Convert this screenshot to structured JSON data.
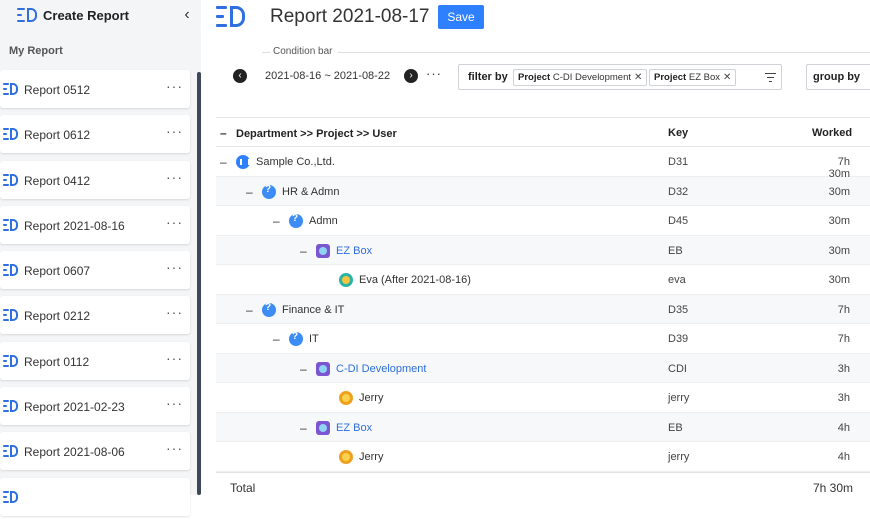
{
  "sidebar": {
    "title": "Create Report",
    "section": "My Report",
    "items": [
      {
        "label": "Report 0512"
      },
      {
        "label": "Report 0612"
      },
      {
        "label": "Report 0412"
      },
      {
        "label": "Report 2021-08-16"
      },
      {
        "label": "Report 0607"
      },
      {
        "label": "Report 0212"
      },
      {
        "label": "Report 0112"
      },
      {
        "label": "Report 2021-02-23"
      },
      {
        "label": "Report 2021-08-06"
      }
    ],
    "more_glyph": "···"
  },
  "header": {
    "title": "Report 2021-08-17",
    "save_label": "Save"
  },
  "condition_bar": {
    "label": "Condition bar",
    "date_range": "2021-08-16 ~ 2021-08-22",
    "more_glyph": "···",
    "filter_label": "filter by",
    "filters": [
      {
        "field": "Project",
        "value": "C-DI Development"
      },
      {
        "field": "Project",
        "value": "EZ Box"
      }
    ],
    "group_label": "group by"
  },
  "table": {
    "header": {
      "name": "Department >> Project >> User",
      "key": "Key",
      "worked": "Worked"
    },
    "rows": [
      {
        "name": "Sample Co.,Ltd.",
        "key": "D31",
        "worked": "7h 30m"
      },
      {
        "name": "HR & Admn",
        "key": "D32",
        "worked": "30m"
      },
      {
        "name": "Admn",
        "key": "D45",
        "worked": "30m"
      },
      {
        "name": "EZ Box",
        "key": "EB",
        "worked": "30m"
      },
      {
        "name": "Eva  (After 2021-08-16)",
        "key": "eva",
        "worked": "30m"
      },
      {
        "name": "Finance & IT",
        "key": "D35",
        "worked": "7h"
      },
      {
        "name": "IT",
        "key": "D39",
        "worked": "7h"
      },
      {
        "name": "C-DI Development",
        "key": "CDI",
        "worked": "3h"
      },
      {
        "name": "Jerry",
        "key": "jerry",
        "worked": "3h"
      },
      {
        "name": "EZ Box",
        "key": "EB",
        "worked": "4h"
      },
      {
        "name": "Jerry",
        "key": "jerry",
        "worked": "4h"
      }
    ],
    "total": {
      "label": "Total",
      "worked": "7h 30m"
    }
  },
  "colors": {
    "accent": "#2f80ff",
    "link": "#2f6fe0"
  }
}
